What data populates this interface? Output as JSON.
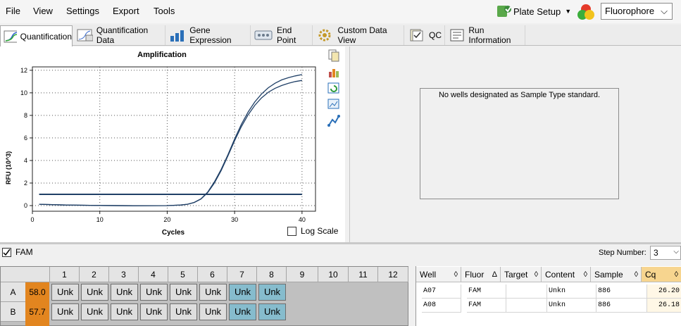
{
  "menu": [
    "File",
    "View",
    "Settings",
    "Export",
    "Tools"
  ],
  "plate_setup_label": "Plate Setup",
  "fluorophore_select": "Fluorophore",
  "tabs": [
    "Quantification",
    "Quantification Data",
    "Gene Expression",
    "End Point",
    "Custom Data View",
    "QC",
    "Run Information"
  ],
  "chart": {
    "title": "Amplification",
    "xlabel": "Cycles",
    "ylabel": "RFU (10^3)",
    "log_scale_label": "Log Scale"
  },
  "chart_data": {
    "type": "line",
    "title": "Amplification",
    "xlabel": "Cycles",
    "ylabel": "RFU (10^3)",
    "xlim": [
      0,
      42
    ],
    "ylim": [
      -0.5,
      12.3
    ],
    "xticks": [
      0,
      10,
      20,
      30,
      40
    ],
    "yticks": [
      0,
      2,
      4,
      6,
      8,
      10,
      12
    ],
    "grid": true,
    "threshold": 1.0,
    "series": [
      {
        "x": [
          1,
          3,
          5,
          10,
          15,
          20,
          22,
          23,
          24,
          25,
          26,
          27,
          28,
          29,
          30,
          31,
          32,
          33,
          34,
          35,
          36,
          37,
          38,
          39,
          40
        ],
        "values": [
          0.12,
          0.08,
          0.05,
          0.01,
          -0.01,
          0.0,
          0.05,
          0.12,
          0.28,
          0.6,
          1.2,
          2.1,
          3.2,
          4.5,
          5.9,
          7.2,
          8.3,
          9.2,
          9.9,
          10.45,
          10.85,
          11.15,
          11.35,
          11.5,
          11.62
        ]
      },
      {
        "x": [
          1,
          3,
          5,
          10,
          15,
          20,
          22,
          23,
          24,
          25,
          26,
          27,
          28,
          29,
          30,
          31,
          32,
          33,
          34,
          35,
          36,
          37,
          38,
          39,
          40
        ],
        "values": [
          0.12,
          0.08,
          0.05,
          0.01,
          -0.01,
          0.0,
          0.05,
          0.12,
          0.27,
          0.58,
          1.15,
          2.0,
          3.1,
          4.4,
          5.75,
          7.0,
          8.05,
          8.9,
          9.55,
          10.05,
          10.4,
          10.65,
          10.85,
          11.0,
          11.1
        ]
      }
    ]
  },
  "standard_message": "No wells designated as Sample Type standard.",
  "fam_label": "FAM",
  "step_number_label": "Step Number:",
  "step_number_value": "3",
  "plate": {
    "columns": [
      "1",
      "2",
      "3",
      "4",
      "5",
      "6",
      "7",
      "8",
      "9",
      "10",
      "11",
      "12"
    ],
    "rows": [
      {
        "label": "A",
        "cq": "58.0",
        "wells": [
          "Unk",
          "Unk",
          "Unk",
          "Unk",
          "Unk",
          "Unk",
          "Unk",
          "Unk"
        ]
      },
      {
        "label": "B",
        "cq": "57.7",
        "wells": [
          "Unk",
          "Unk",
          "Unk",
          "Unk",
          "Unk",
          "Unk",
          "Unk",
          "Unk"
        ]
      }
    ]
  },
  "results": {
    "headers": [
      "Well",
      "Fluor",
      "Target",
      "Content",
      "Sample",
      "Cq"
    ],
    "rows": [
      [
        "A07",
        "FAM",
        "",
        "Unkn",
        "886",
        "26.20"
      ],
      [
        "A08",
        "FAM",
        "",
        "Unkn",
        "886",
        "26.18"
      ]
    ]
  },
  "colors": {
    "accent_cq": "#e2851f",
    "selected_well": "#86bccd",
    "curve": "#1f3f66"
  }
}
